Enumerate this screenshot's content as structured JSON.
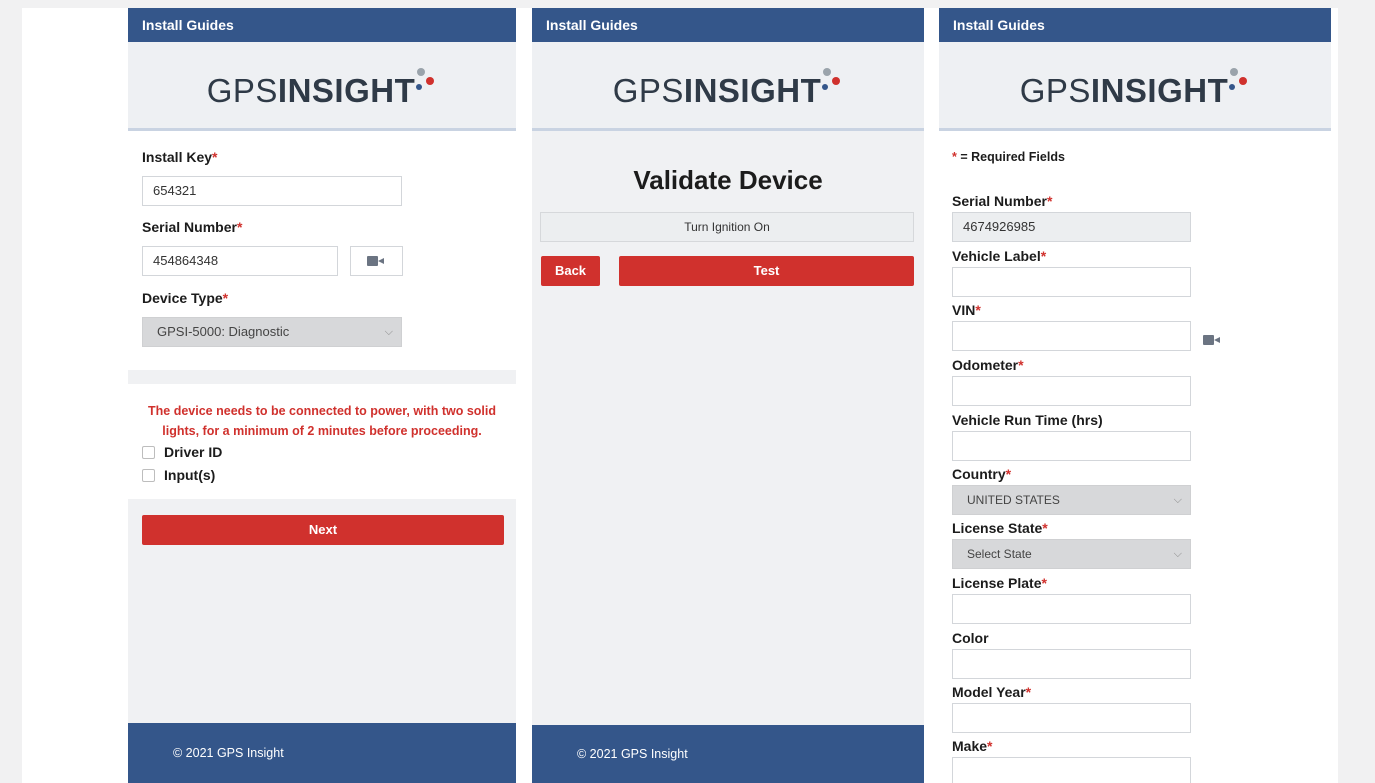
{
  "app": {
    "header_title": "Install Guides",
    "logo_light": "GPS",
    "logo_bold": "INSIGHT",
    "footer": "© 2021 GPS Insight",
    "required_mark": "*"
  },
  "panel1": {
    "install_key": {
      "label": "Install Key",
      "value": "654321"
    },
    "serial_number": {
      "label": "Serial Number",
      "value": "454864348"
    },
    "device_type": {
      "label": "Device Type",
      "selected": "GPSI-5000: Diagnostic"
    },
    "warning": "The device needs to be connected to power, with two solid lights, for a minimum of 2 minutes before proceeding.",
    "checkboxes": [
      {
        "label": "Driver ID"
      },
      {
        "label": "Input(s)"
      }
    ],
    "next_label": "Next"
  },
  "panel2": {
    "title": "Validate Device",
    "status": "Turn Ignition On",
    "back_label": "Back",
    "test_label": "Test"
  },
  "panel3": {
    "required_note": "= Required Fields",
    "serial_number": {
      "label": "Serial Number",
      "value": "4674926985"
    },
    "vehicle_label": {
      "label": "Vehicle Label"
    },
    "vin": {
      "label": "VIN"
    },
    "odometer": {
      "label": "Odometer"
    },
    "run_time": {
      "label": "Vehicle Run Time (hrs)"
    },
    "country": {
      "label": "Country",
      "selected": "UNITED STATES"
    },
    "license_state": {
      "label": "License State",
      "selected": "Select State"
    },
    "license_plate": {
      "label": "License Plate"
    },
    "color": {
      "label": "Color"
    },
    "model_year": {
      "label": "Model Year"
    },
    "make": {
      "label": "Make"
    }
  },
  "colors": {
    "header_blue": "#34568a",
    "accent_red": "#d0312d"
  }
}
